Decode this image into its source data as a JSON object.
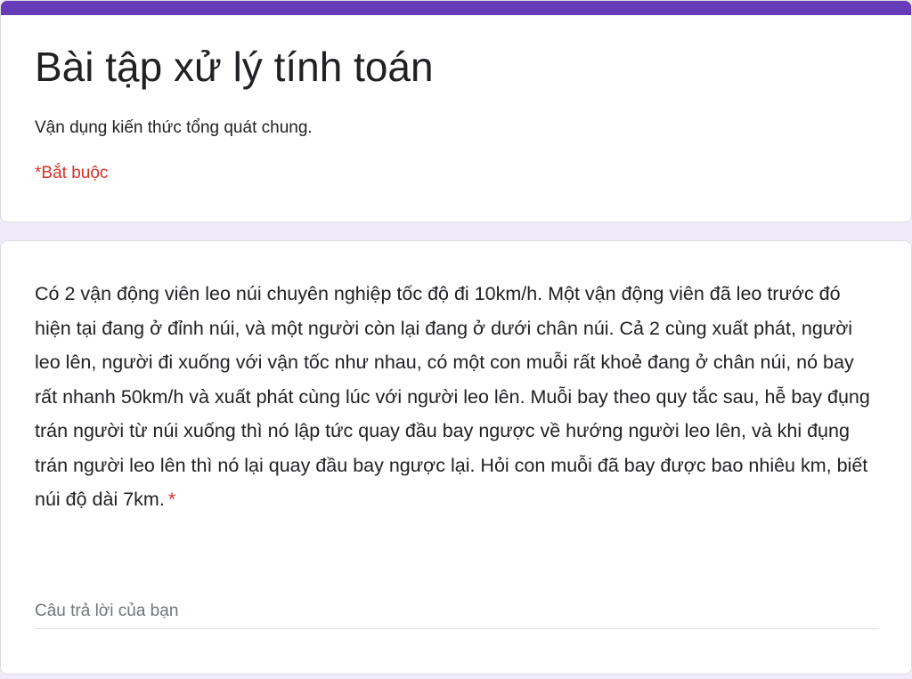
{
  "form": {
    "title": "Bài tập xử lý tính toán",
    "description": "Vận dụng kiến thức tổng quát chung.",
    "required_note": "*Bắt buộc",
    "accent_color": "#673ab7",
    "background_color": "#f0ebf8",
    "required_color": "#d93025"
  },
  "question": {
    "text": "Có 2 vận động viên leo núi chuyên nghiệp tốc độ đi 10km/h. Một vận động viên đã leo trước đó hiện tại đang ở đỉnh núi, và một người còn lại đang ở dưới chân núi. Cả 2 cùng xuất phát, người leo lên, người đi xuống với vận tốc như nhau, có một con muỗi rất khoẻ đang ở chân núi, nó bay rất nhanh 50km/h và xuất phát cùng lúc với người leo lên. Muỗi bay theo quy tắc sau, hễ bay đụng trán người từ núi xuống thì nó lập tức quay đầu bay ngược về hướng người leo lên, và khi đụng trán người leo lên thì nó lại quay đầu bay ngược lại. Hỏi con muỗi đã bay được bao nhiêu km, biết núi độ dài 7km.",
    "required_marker": "*",
    "answer_placeholder": "Câu trả lời của bạn",
    "answer_value": ""
  }
}
